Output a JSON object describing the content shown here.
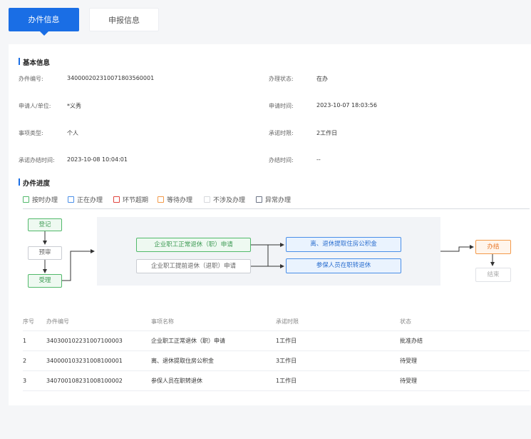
{
  "tabs": [
    {
      "label": "办件信息",
      "active": true
    },
    {
      "label": "申报信息",
      "active": false
    }
  ],
  "basic": {
    "title": "基本信息",
    "fields": {
      "case_no_label": "办件编号:",
      "case_no": "340000202310071803560001",
      "status_label": "办理状态:",
      "status": "在办",
      "applicant_label": "申请人/单位:",
      "applicant": "*义秀",
      "apply_time_label": "申请时间:",
      "apply_time": "2023-10-07 18:03:56",
      "type_label": "事项类型:",
      "type": "个人",
      "promise_label": "承诺时限:",
      "promise": "2工作日",
      "promise_finish_label": "承诺办结时间:",
      "promise_finish": "2023-10-08 10:04:01",
      "finish_label": "办结时间:",
      "finish": "--"
    }
  },
  "progress": {
    "title": "办件进度",
    "legend": [
      {
        "label": "按时办理",
        "color": "#52b96b"
      },
      {
        "label": "正在办理",
        "color": "#4a8fe8"
      },
      {
        "label": "环节超期",
        "color": "#e0443e"
      },
      {
        "label": "等待办理",
        "color": "#f39a4a"
      },
      {
        "label": "不涉及办理",
        "color": "#d6d8dc"
      },
      {
        "label": "异常办理",
        "color": "#6b7385"
      }
    ],
    "nodes": {
      "register": "登记",
      "precheck": "预审",
      "accept": "受理",
      "normal_retire": "企业职工正常退休（职）申请",
      "early_retire": "企业职工提前退休（退职）申请",
      "housing_fund": "离、退休提取住房公积金",
      "insured_retire": "参保人员在职转退休",
      "done": "办结",
      "end": "结束"
    }
  },
  "table": {
    "headers": [
      "序号",
      "办件编号",
      "事项名称",
      "承诺时限",
      "状态"
    ],
    "rows": [
      [
        "1",
        "340300102231007100003",
        "企业职工正常退休（职）申请",
        "1工作日",
        "批准办结"
      ],
      [
        "2",
        "340000103231008100001",
        "离、退休提取住房公积金",
        "3工作日",
        "待受理"
      ],
      [
        "3",
        "340700108231008100002",
        "参保人员在职转退休",
        "1工作日",
        "待受理"
      ]
    ]
  }
}
